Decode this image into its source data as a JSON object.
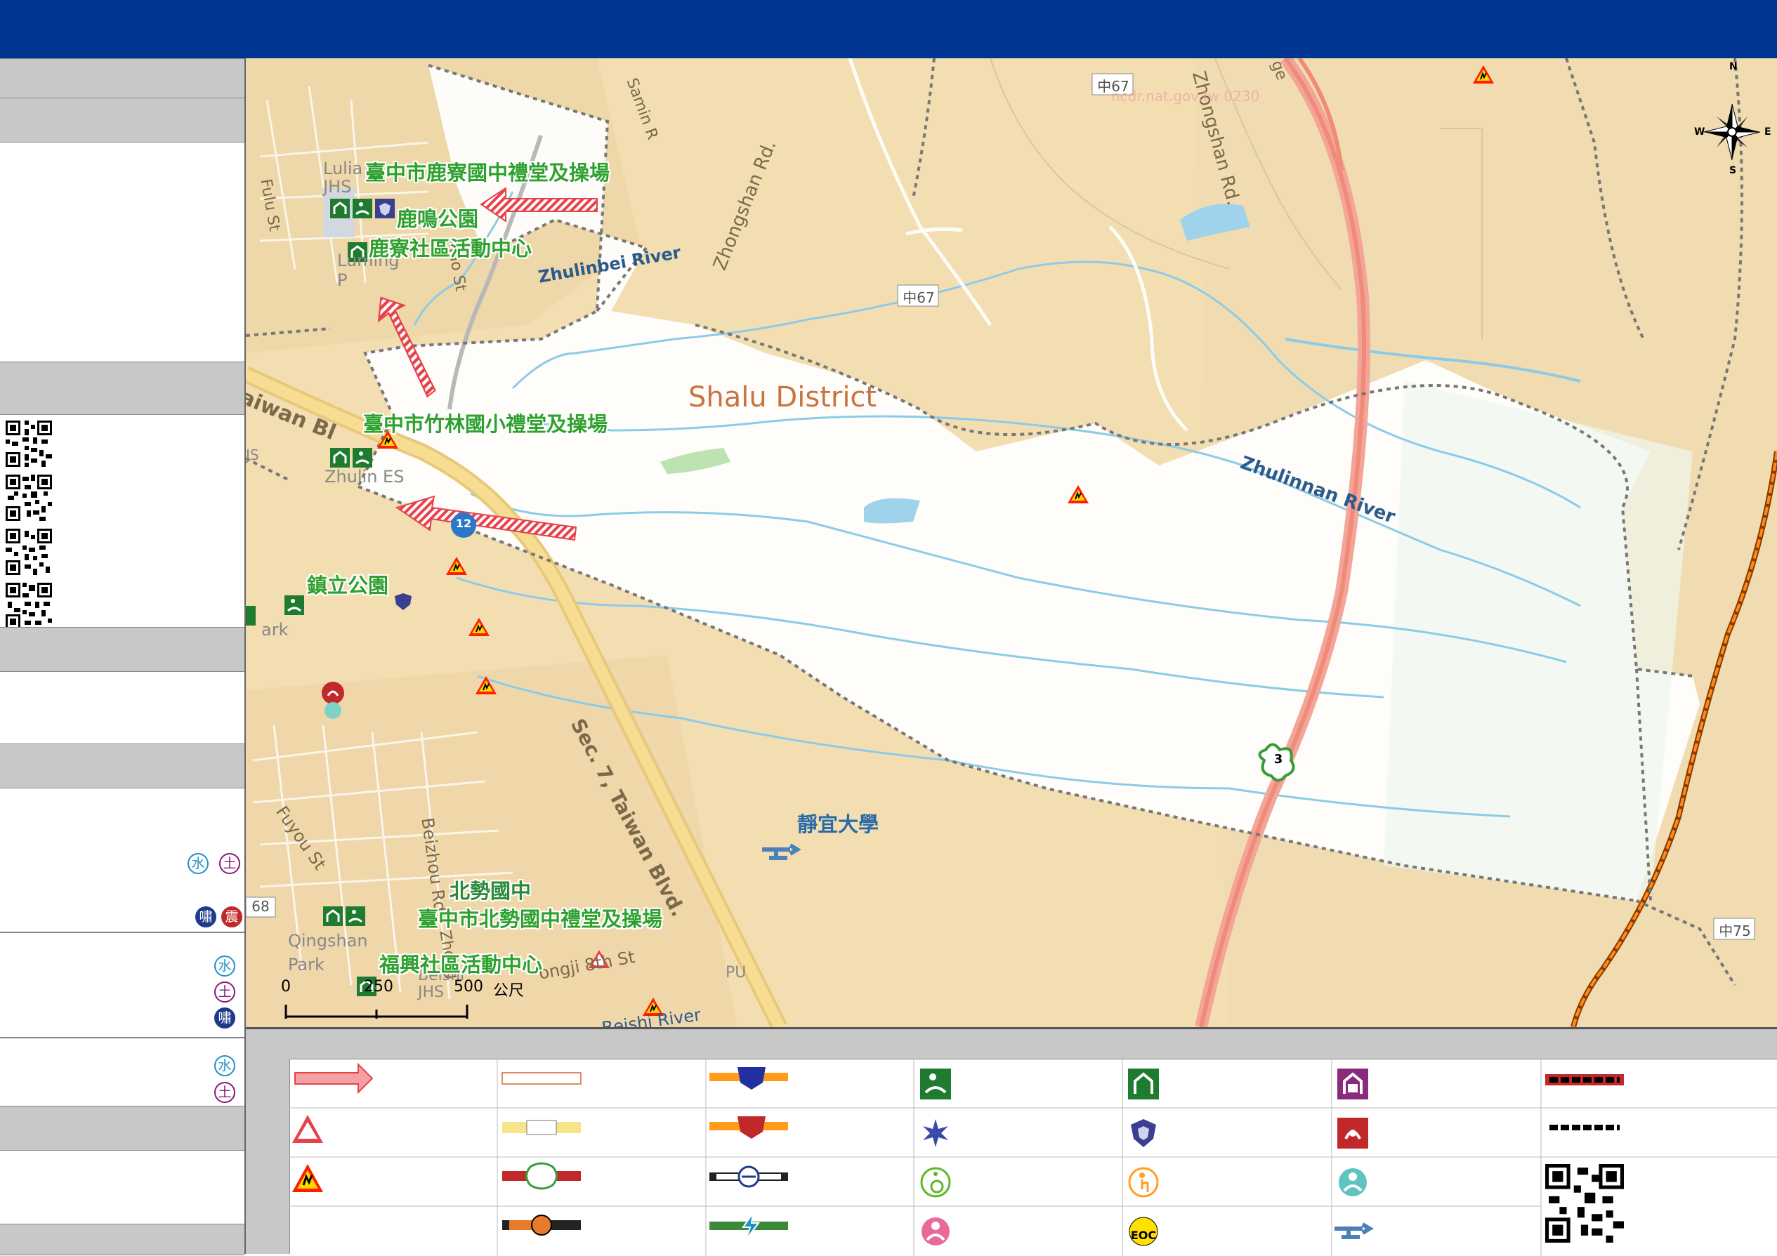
{
  "map": {
    "district": "Shalu District",
    "river_north": "Zhulinbei River",
    "river_south": "Zhulinnan River",
    "roads": {
      "zhongshan_rd": "Zhongshan Rd.",
      "zhongshan_rd_ne": "Zhongshan Rd.",
      "taiwan_blvd": "Sec. 7, Taiwan Blvd.",
      "taiwan_bl_west": "aiwan Bl",
      "fulu_st": "Fulu St",
      "fuyou_st": "Fuyou St",
      "beizhou_rd": "Beizhou Rd",
      "beishi_river": "Beishi River",
      "samin_rd": "Samin R",
      "gongji_8th": "ongji 8th St",
      "zhong_st": "Zhong",
      "fenxiao_st": "xiao St",
      "bridge": "ge"
    },
    "route_shields": {
      "c67_top": "中67",
      "c67_mid": "中67",
      "c75": "中75",
      "c68": "68",
      "hwy3": "3",
      "hwy12": "12"
    },
    "places": {
      "luliao_jhs": "Lulia JHS",
      "luming_park": "Luming P",
      "zhulin_es": "Zhulin ES",
      "park": "ark",
      "qingshan_park": "Qingshan Park",
      "beishi_jhs": "Beishi JHS",
      "pu": "PU",
      "js": "JS"
    },
    "labels": {
      "shelter1": "臺中市鹿寮國中禮堂及操場",
      "shelter2": "鹿鳴公園",
      "shelter3": "鹿寮社區活動中心",
      "shelter4": "臺中市竹林國小禮堂及操場",
      "shelter5": "鎮立公園",
      "shelter6": "北勢國中",
      "shelter7": "臺中市北勢國中禮堂及操場",
      "shelter8": "福興社區活動中心",
      "university": "靜宜大學"
    },
    "watermark": "ncdr.nat.gov.tw 0230",
    "scale": {
      "t0": "0",
      "t1": "250",
      "t2": "500",
      "unit": "公尺"
    },
    "compass": {
      "n": "N",
      "s": "S",
      "e": "E",
      "w": "W"
    }
  },
  "sidebar": {
    "disasters": {
      "water": "水",
      "soil": "土",
      "tsunami": "嘯",
      "quake": "震"
    }
  },
  "colors": {
    "topbar": "#003591",
    "header_gray": "#c8c8c8",
    "shelter_green": "#2ea12e",
    "evac_arrow": "#e8414a",
    "boundary": "#777777",
    "river": "#8ccbe8",
    "highway": "#f08b78"
  }
}
